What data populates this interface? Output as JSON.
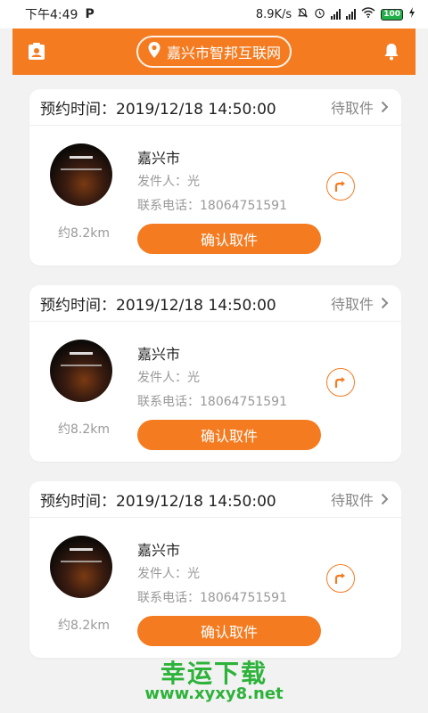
{
  "statusbar": {
    "time": "下午4:49",
    "app_glyph": "P",
    "speed": "8.9K/s",
    "battery": "100"
  },
  "header": {
    "location": "嘉兴市智邦互联网"
  },
  "cards": [
    {
      "title": "预约时间：2019/12/18 14:50:00",
      "status": "待取件",
      "city": "嘉兴市",
      "sender": "发件人：光",
      "phone": "联系电话：18064751591",
      "distance": "约8.2km",
      "button": "确认取件"
    },
    {
      "title": "预约时间：2019/12/18 14:50:00",
      "status": "待取件",
      "city": "嘉兴市",
      "sender": "发件人：光",
      "phone": "联系电话：18064751591",
      "distance": "约8.2km",
      "button": "确认取件"
    },
    {
      "title": "预约时间：2019/12/18 14:50:00",
      "status": "待取件",
      "city": "嘉兴市",
      "sender": "发件人：光",
      "phone": "联系电话：18064751591",
      "distance": "约8.2km",
      "button": "确认取件"
    }
  ],
  "watermark": {
    "line1": "幸运下载",
    "line2": "www.xyxy8.net"
  },
  "colors": {
    "accent": "#f47b20",
    "background": "#f2f2f2",
    "watermark": "#2db23a"
  },
  "icons": [
    "contact-card-icon",
    "location-pin-icon",
    "bell-icon",
    "chevron-right-icon",
    "turn-right-icon"
  ]
}
